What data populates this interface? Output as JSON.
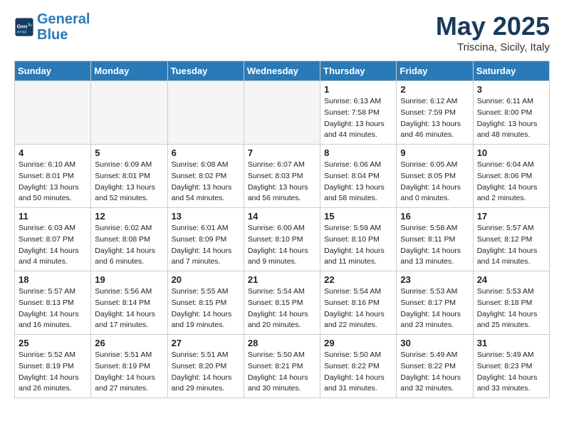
{
  "header": {
    "logo_line1": "General",
    "logo_line2": "Blue",
    "month": "May 2025",
    "location": "Triscina, Sicily, Italy"
  },
  "days_of_week": [
    "Sunday",
    "Monday",
    "Tuesday",
    "Wednesday",
    "Thursday",
    "Friday",
    "Saturday"
  ],
  "weeks": [
    [
      {
        "num": "",
        "empty": true
      },
      {
        "num": "",
        "empty": true
      },
      {
        "num": "",
        "empty": true
      },
      {
        "num": "",
        "empty": true
      },
      {
        "num": "1",
        "rise": "6:13 AM",
        "set": "7:58 PM",
        "daylight": "13 hours and 44 minutes."
      },
      {
        "num": "2",
        "rise": "6:12 AM",
        "set": "7:59 PM",
        "daylight": "13 hours and 46 minutes."
      },
      {
        "num": "3",
        "rise": "6:11 AM",
        "set": "8:00 PM",
        "daylight": "13 hours and 48 minutes."
      }
    ],
    [
      {
        "num": "4",
        "rise": "6:10 AM",
        "set": "8:01 PM",
        "daylight": "13 hours and 50 minutes."
      },
      {
        "num": "5",
        "rise": "6:09 AM",
        "set": "8:01 PM",
        "daylight": "13 hours and 52 minutes."
      },
      {
        "num": "6",
        "rise": "6:08 AM",
        "set": "8:02 PM",
        "daylight": "13 hours and 54 minutes."
      },
      {
        "num": "7",
        "rise": "6:07 AM",
        "set": "8:03 PM",
        "daylight": "13 hours and 56 minutes."
      },
      {
        "num": "8",
        "rise": "6:06 AM",
        "set": "8:04 PM",
        "daylight": "13 hours and 58 minutes."
      },
      {
        "num": "9",
        "rise": "6:05 AM",
        "set": "8:05 PM",
        "daylight": "14 hours and 0 minutes."
      },
      {
        "num": "10",
        "rise": "6:04 AM",
        "set": "8:06 PM",
        "daylight": "14 hours and 2 minutes."
      }
    ],
    [
      {
        "num": "11",
        "rise": "6:03 AM",
        "set": "8:07 PM",
        "daylight": "14 hours and 4 minutes."
      },
      {
        "num": "12",
        "rise": "6:02 AM",
        "set": "8:08 PM",
        "daylight": "14 hours and 6 minutes."
      },
      {
        "num": "13",
        "rise": "6:01 AM",
        "set": "8:09 PM",
        "daylight": "14 hours and 7 minutes."
      },
      {
        "num": "14",
        "rise": "6:00 AM",
        "set": "8:10 PM",
        "daylight": "14 hours and 9 minutes."
      },
      {
        "num": "15",
        "rise": "5:59 AM",
        "set": "8:10 PM",
        "daylight": "14 hours and 11 minutes."
      },
      {
        "num": "16",
        "rise": "5:58 AM",
        "set": "8:11 PM",
        "daylight": "14 hours and 13 minutes."
      },
      {
        "num": "17",
        "rise": "5:57 AM",
        "set": "8:12 PM",
        "daylight": "14 hours and 14 minutes."
      }
    ],
    [
      {
        "num": "18",
        "rise": "5:57 AM",
        "set": "8:13 PM",
        "daylight": "14 hours and 16 minutes."
      },
      {
        "num": "19",
        "rise": "5:56 AM",
        "set": "8:14 PM",
        "daylight": "14 hours and 17 minutes."
      },
      {
        "num": "20",
        "rise": "5:55 AM",
        "set": "8:15 PM",
        "daylight": "14 hours and 19 minutes."
      },
      {
        "num": "21",
        "rise": "5:54 AM",
        "set": "8:15 PM",
        "daylight": "14 hours and 20 minutes."
      },
      {
        "num": "22",
        "rise": "5:54 AM",
        "set": "8:16 PM",
        "daylight": "14 hours and 22 minutes."
      },
      {
        "num": "23",
        "rise": "5:53 AM",
        "set": "8:17 PM",
        "daylight": "14 hours and 23 minutes."
      },
      {
        "num": "24",
        "rise": "5:53 AM",
        "set": "8:18 PM",
        "daylight": "14 hours and 25 minutes."
      }
    ],
    [
      {
        "num": "25",
        "rise": "5:52 AM",
        "set": "8:19 PM",
        "daylight": "14 hours and 26 minutes."
      },
      {
        "num": "26",
        "rise": "5:51 AM",
        "set": "8:19 PM",
        "daylight": "14 hours and 27 minutes."
      },
      {
        "num": "27",
        "rise": "5:51 AM",
        "set": "8:20 PM",
        "daylight": "14 hours and 29 minutes."
      },
      {
        "num": "28",
        "rise": "5:50 AM",
        "set": "8:21 PM",
        "daylight": "14 hours and 30 minutes."
      },
      {
        "num": "29",
        "rise": "5:50 AM",
        "set": "8:22 PM",
        "daylight": "14 hours and 31 minutes."
      },
      {
        "num": "30",
        "rise": "5:49 AM",
        "set": "8:22 PM",
        "daylight": "14 hours and 32 minutes."
      },
      {
        "num": "31",
        "rise": "5:49 AM",
        "set": "8:23 PM",
        "daylight": "14 hours and 33 minutes."
      }
    ]
  ],
  "labels": {
    "sunrise": "Sunrise:",
    "sunset": "Sunset:",
    "daylight": "Daylight:"
  }
}
